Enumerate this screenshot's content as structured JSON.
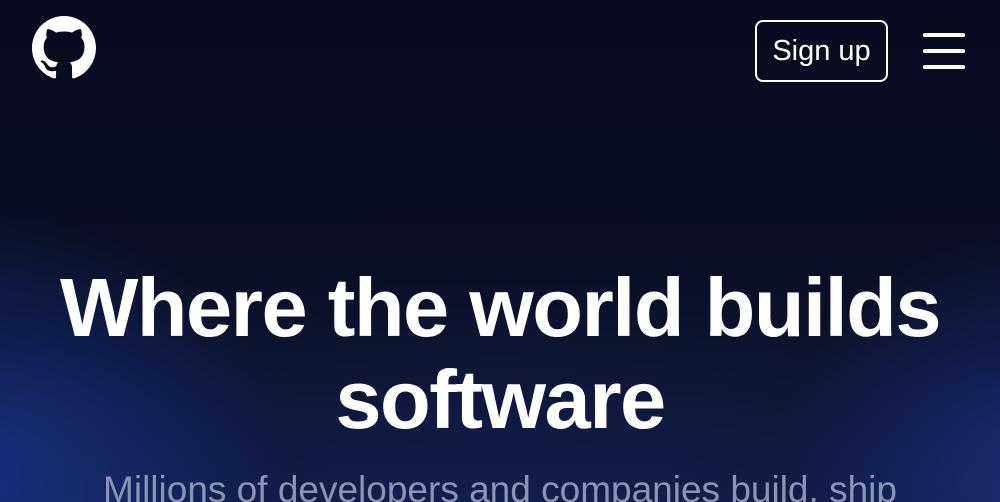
{
  "header": {
    "logo_icon": "github-mark-icon",
    "signup_label": "Sign up",
    "menu_icon": "hamburger-menu-icon"
  },
  "hero": {
    "title": "Where the world builds software",
    "subtitle": "Millions of developers and companies build, ship"
  },
  "colors": {
    "background": "#0b0e20",
    "accent_glow": "#1e46be",
    "text": "#ffffff",
    "subtitle_text": "#8a95b5"
  }
}
